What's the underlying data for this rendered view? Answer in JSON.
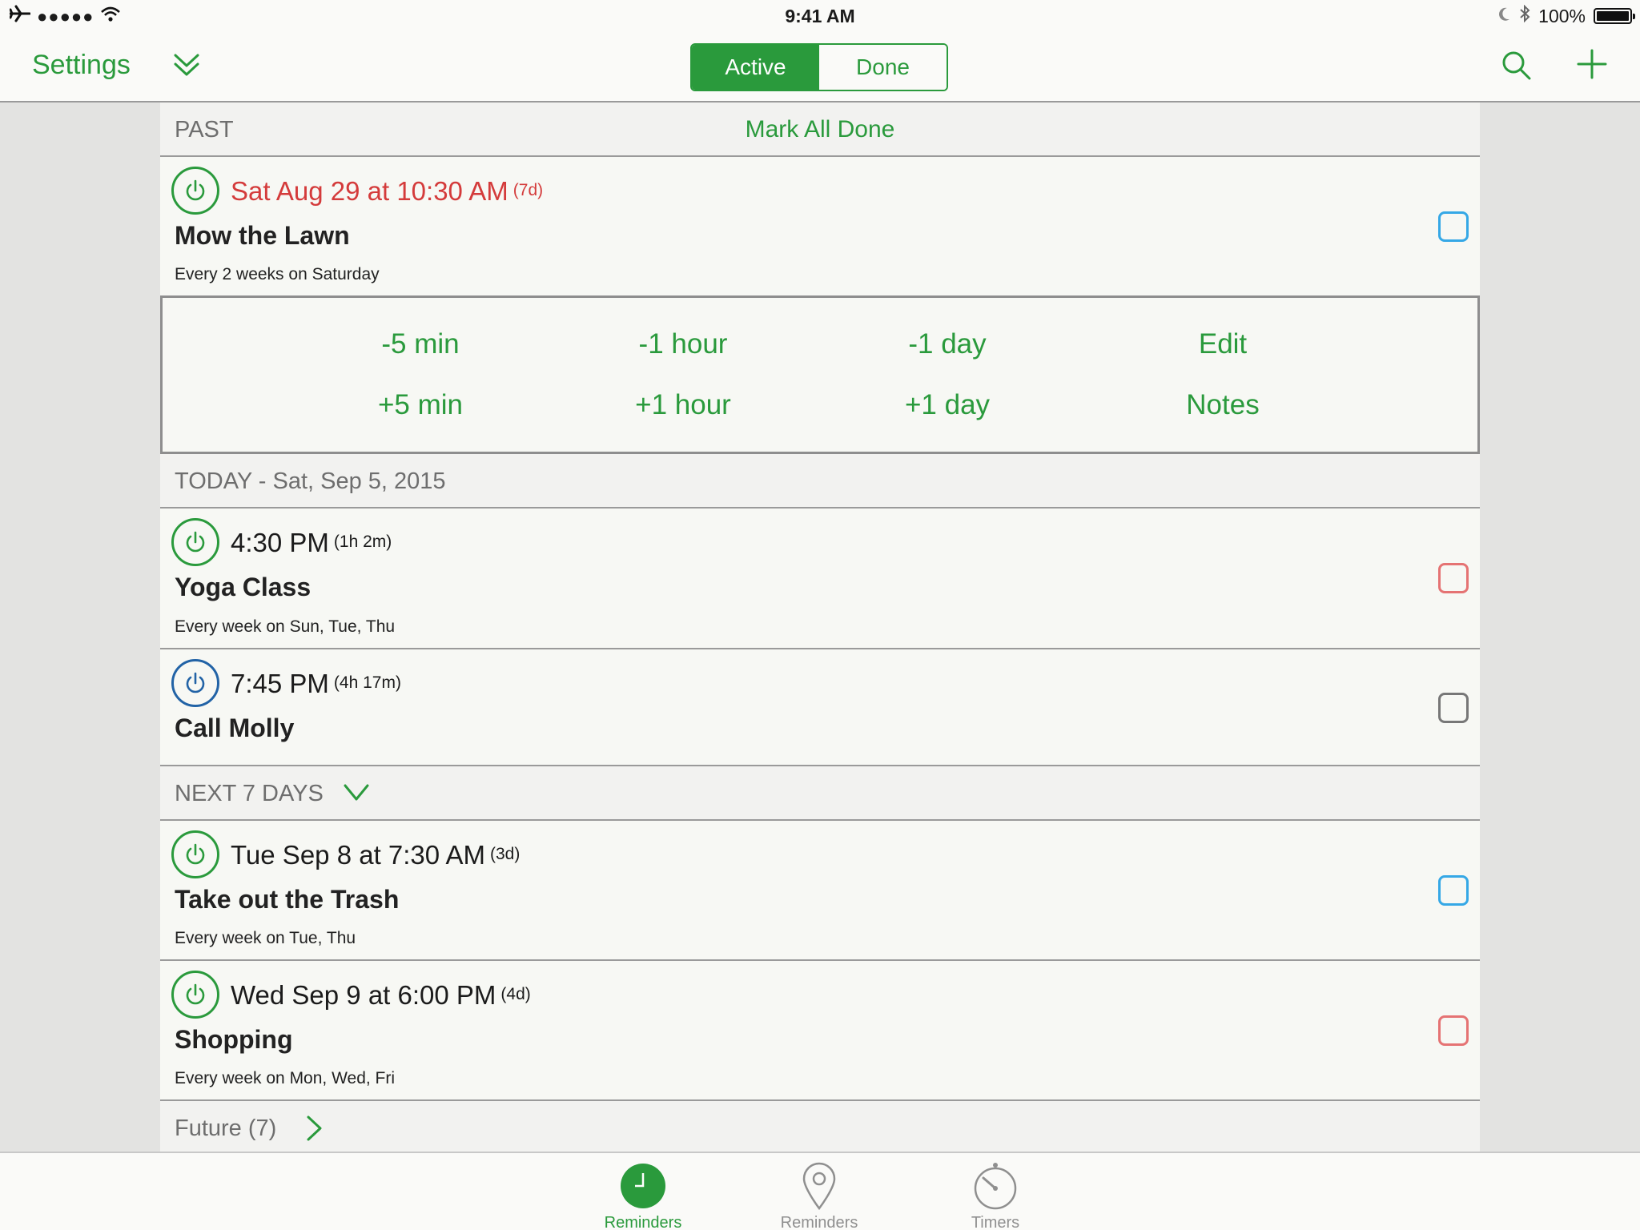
{
  "statusbar": {
    "signal": "●●●●●",
    "time": "9:41 AM",
    "battery": "100%"
  },
  "nav": {
    "settings": "Settings",
    "segments": {
      "active": "Active",
      "done": "Done"
    }
  },
  "sections": {
    "past": {
      "label": "PAST",
      "action": "Mark All Done"
    },
    "today": {
      "label": "TODAY - Sat, Sep 5, 2015"
    },
    "next7": {
      "label": "NEXT 7 DAYS"
    },
    "future": {
      "label": "Future (7)"
    }
  },
  "reminders": [
    {
      "time": "Sat Aug 29 at 10:30 AM",
      "rel": "(7d)",
      "title": "Mow the Lawn",
      "repeat": "Every 2 weeks on Saturday",
      "checkbox_color": "#35a8e6"
    },
    {
      "time": "4:30 PM",
      "rel": "(1h 2m)",
      "title": "Yoga Class",
      "repeat": "Every week on Sun, Tue, Thu",
      "checkbox_color": "#e57373"
    },
    {
      "time": "7:45 PM",
      "rel": "(4h 17m)",
      "title": "Call Molly",
      "repeat": "",
      "checkbox_color": "#777777"
    },
    {
      "time": "Tue Sep 8 at 7:30 AM",
      "rel": "(3d)",
      "title": "Take out the Trash",
      "repeat": "Every week on Tue, Thu",
      "checkbox_color": "#35a8e6"
    },
    {
      "time": "Wed Sep 9 at 6:00 PM",
      "rel": "(4d)",
      "title": "Shopping",
      "repeat": "Every week on Mon, Wed, Fri",
      "checkbox_color": "#e57373"
    }
  ],
  "actions": {
    "minus5min": "-5 min",
    "plus5min": "+5 min",
    "minus1hour": "-1 hour",
    "plus1hour": "+1 hour",
    "minus1day": "-1 day",
    "plus1day": "+1 day",
    "edit": "Edit",
    "notes": "Notes"
  },
  "tabs": [
    {
      "label": "Reminders",
      "icon": "clock-icon"
    },
    {
      "label": "Reminders",
      "icon": "location-pin-icon"
    },
    {
      "label": "Timers",
      "icon": "timer-icon"
    }
  ],
  "colors": {
    "accent": "#2a9a3c",
    "overdue": "#d43b3b"
  }
}
